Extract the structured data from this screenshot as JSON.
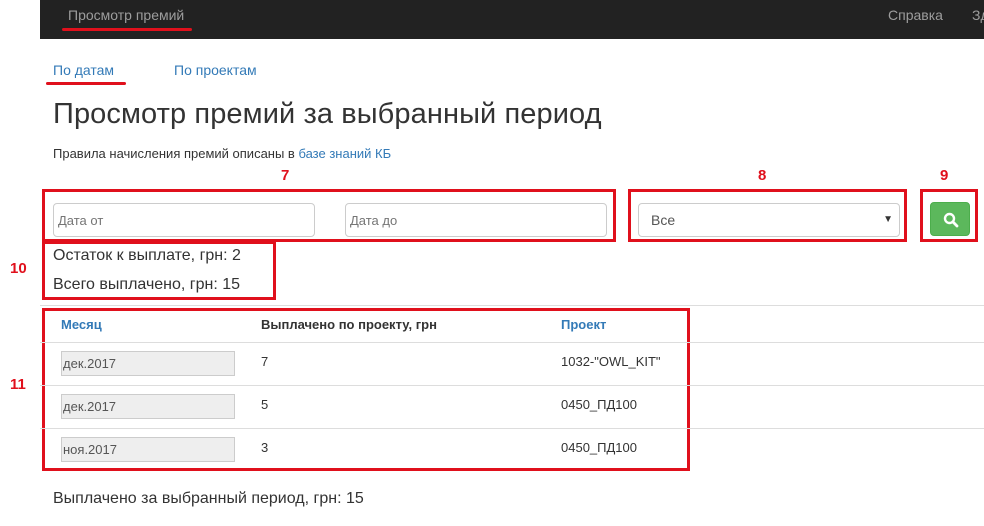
{
  "navbar": {
    "brand": "Просмотр премий",
    "help": "Справка",
    "cut_item": "Зд"
  },
  "tabs": {
    "by_dates": "По датам",
    "by_projects": "По проектам"
  },
  "page": {
    "title": "Просмотр премий за выбранный период",
    "rules_text": "Правила начисления премий описаны в ",
    "rules_link": "базе знаний КБ"
  },
  "filters": {
    "date_from_placeholder": "Дата от",
    "date_to_placeholder": "Дата до",
    "project_selected": "Все"
  },
  "summary": {
    "remaining": "Остаток к выплате, грн: 2",
    "paid_total": "Всего выплачено, грн: 15"
  },
  "table": {
    "headers": {
      "month": "Месяц",
      "paid": "Выплачено по проекту, грн",
      "project": "Проект"
    },
    "rows": [
      {
        "month": "дек.2017",
        "paid": "7",
        "project": "1032-\"OWL_KIT\""
      },
      {
        "month": "дек.2017",
        "paid": "5",
        "project": "0450_ПД100"
      },
      {
        "month": "ноя.2017",
        "paid": "3",
        "project": "0450_ПД100"
      }
    ]
  },
  "footer": {
    "period_total": "Выплачено за выбранный период, грн: 15"
  },
  "annotations": {
    "n7": "7",
    "n8": "8",
    "n9": "9",
    "n10": "10",
    "n11": "11"
  },
  "colors": {
    "annotation_red": "#e0101c",
    "link_blue": "#337ab7",
    "button_green": "#5cb85c",
    "navbar_bg": "#222222"
  }
}
